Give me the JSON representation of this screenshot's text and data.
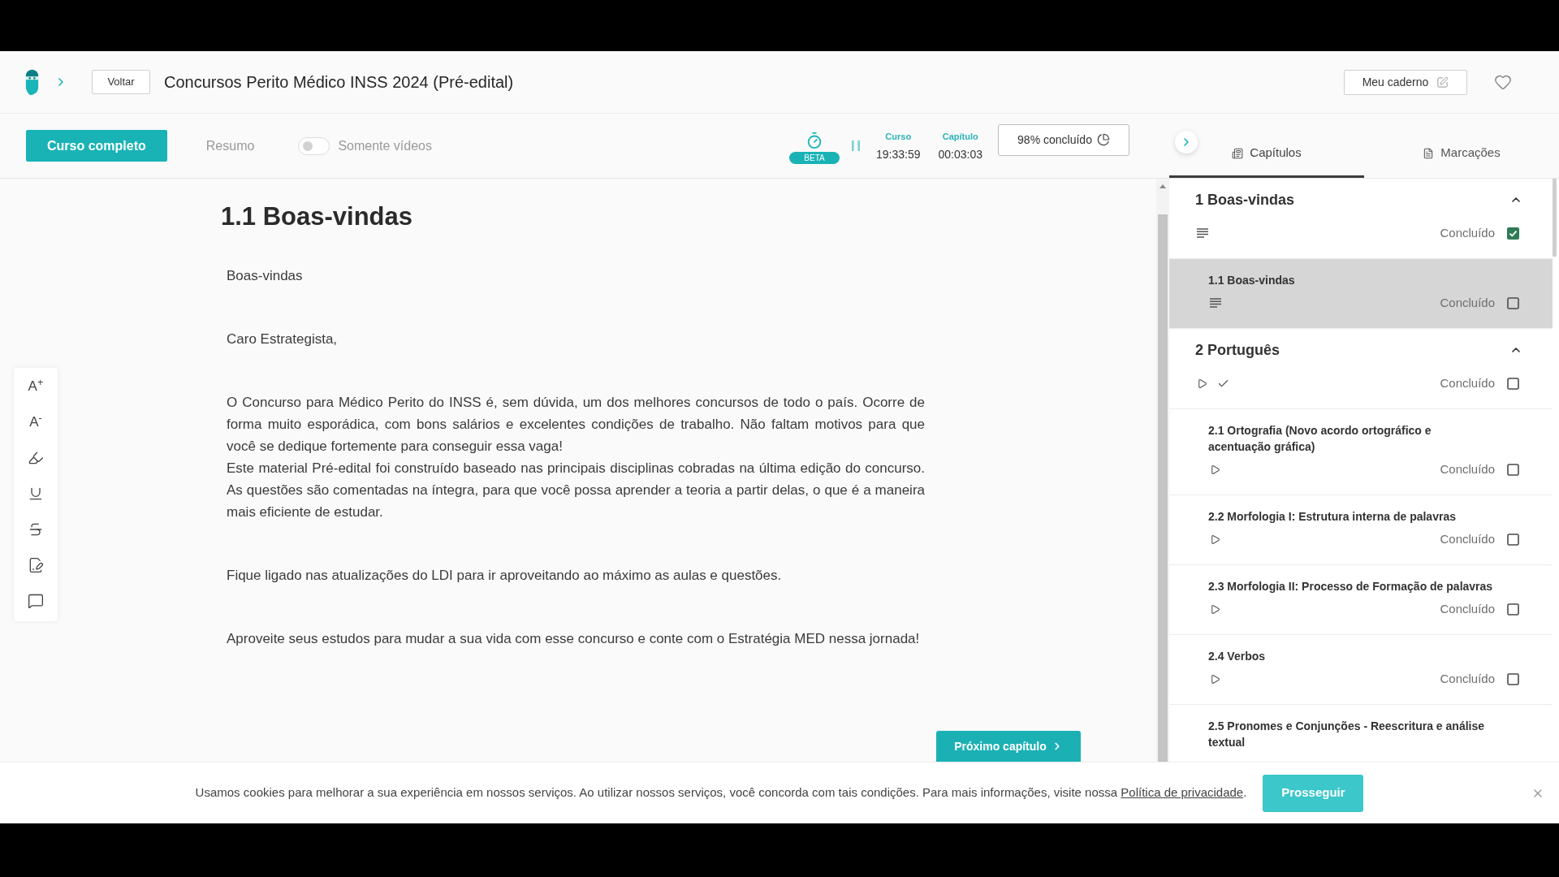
{
  "header": {
    "back_button": "Voltar",
    "course_title": "Concursos Perito Médico INSS 2024 (Pré-edital)",
    "notebook_button": "Meu caderno"
  },
  "toolbar": {
    "modes": [
      {
        "label": "Curso completo",
        "selected": true
      },
      {
        "label": "Resumo",
        "selected": false
      }
    ],
    "videos_only": {
      "label": "Somente vídeos",
      "on": false
    },
    "timer_badge": "BETA",
    "counters": [
      {
        "label": "Curso",
        "value": "19:33:59"
      },
      {
        "label": "Capítulo",
        "value": "00:03:03"
      }
    ],
    "progress_button": "98% concluído"
  },
  "editor_tools": [
    {
      "kind": "text",
      "label": "A$^{+}$"
    },
    {
      "kind": "text",
      "label": "A$^{-}$"
    },
    {
      "kind": "highlighter"
    },
    {
      "kind": "underline"
    },
    {
      "kind": "strikethrough"
    },
    {
      "kind": "note"
    },
    {
      "kind": "comment"
    }
  ],
  "content": {
    "title": "1.1 Boas-vindas",
    "blocks": [
      [
        "Boas-vindas"
      ],
      [
        "Caro Estrategista,"
      ],
      [
        "O Concurso para Médico Perito do INSS é, sem dúvida, um dos melhores concursos de todo o país. Ocorre de forma muito esporádica, com bons salários e excelentes condições de trabalho. Não faltam motivos para que você se dedique fortemente para conseguir essa vaga!",
        "Este material Pré-edital foi construído baseado nas principais disciplinas cobradas na última edição do concurso. As questões são comentadas na íntegra, para que você possa aprender a teoria a partir delas, o que é a maneira mais eficiente de estudar."
      ],
      [
        "Fique ligado nas atualizações do LDI para ir aproveitando ao máximo as aulas e questões."
      ],
      [
        "Aproveite seus estudos para mudar a sua vida com esse concurso e conte com o Estratégia MED nessa jornada!"
      ]
    ],
    "next_button": "Próximo capítulo"
  },
  "sidebar": {
    "tabs": [
      {
        "label": "Capítulos",
        "selected": true
      },
      {
        "label": "Marcações",
        "selected": false
      }
    ],
    "chapters": [
      {
        "title": "1 Boas-vindas",
        "expanded": true,
        "kind": "text",
        "viewed": false,
        "status": "Concluído",
        "done": true,
        "children": [
          {
            "title": "1.1 Boas-vindas",
            "selected": true,
            "kind": "text",
            "viewed": false,
            "status": "Concluído",
            "done": false
          }
        ]
      },
      {
        "title": "2 Português",
        "expanded": true,
        "kind": "video",
        "viewed": true,
        "status": "Concluído",
        "done": false,
        "children": [
          {
            "title": "2.1 Ortografia (Novo acordo ortográfico e acentuação gráfica)",
            "selected": false,
            "kind": "video",
            "viewed": false,
            "status": "Concluído",
            "done": false
          },
          {
            "title": "2.2 Morfologia I: Estrutura interna de palavras",
            "selected": false,
            "kind": "video",
            "viewed": false,
            "status": "Concluído",
            "done": false
          },
          {
            "title": "2.3 Morfologia II: Processo de Formação de palavras",
            "selected": false,
            "kind": "video",
            "viewed": false,
            "status": "Concluído",
            "done": false
          },
          {
            "title": "2.4 Verbos",
            "selected": false,
            "kind": "video",
            "viewed": false,
            "status": "Concluído",
            "done": false
          },
          {
            "title": "2.5 Pronomes e Conjunções - Reescritura e análise textual",
            "selected": false
          }
        ]
      }
    ]
  },
  "cookie_bar": {
    "message": "Usamos cookies para melhorar a sua experiência em nossos serviços. Ao utilizar nossos serviços, você concorda com tais condições. Para mais informações, visite nossa",
    "link": "Política de privacidade",
    "message_end": ".",
    "button": "Prosseguir"
  }
}
